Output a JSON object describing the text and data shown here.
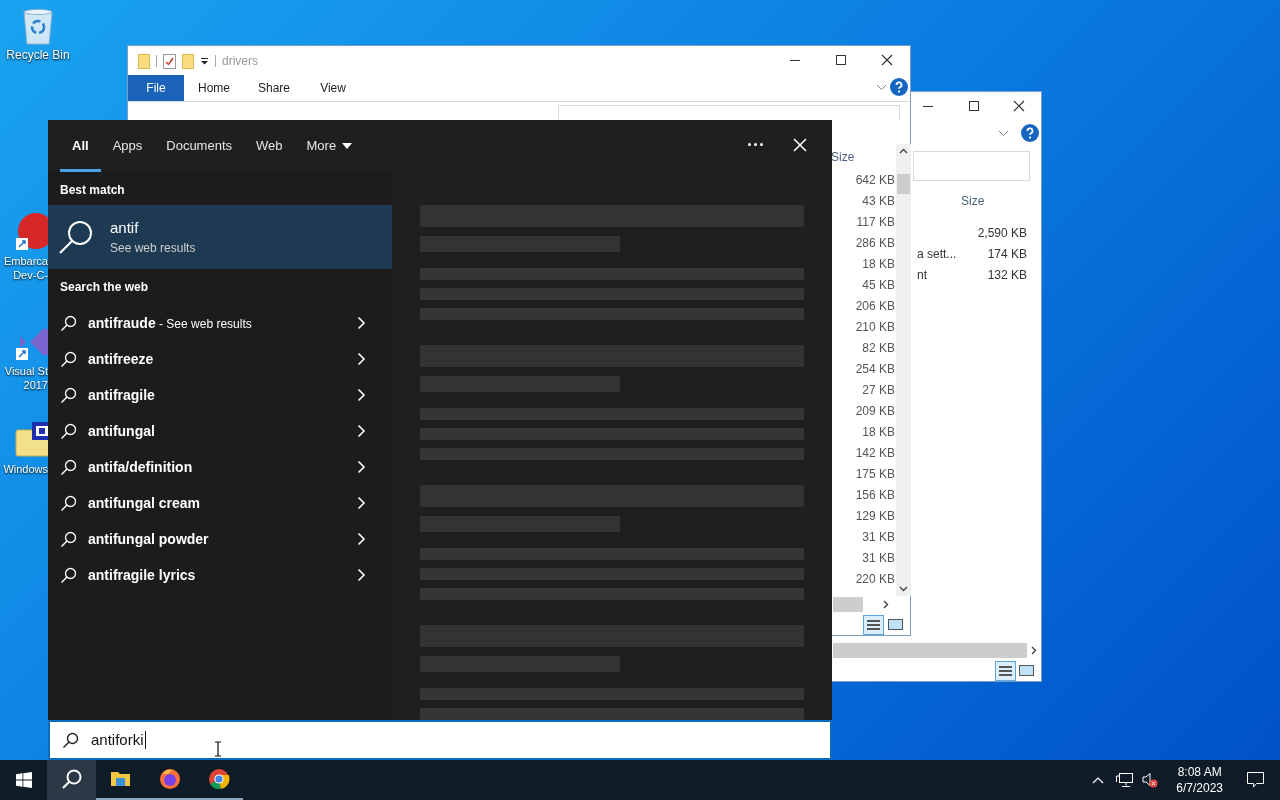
{
  "desktop_icons": [
    {
      "kind": "recycle",
      "lines": [
        "Recycle Bin"
      ]
    },
    {
      "kind": "devcpp",
      "lines": [
        "Embarca",
        "Dev-C-"
      ]
    },
    {
      "kind": "studio",
      "lines": [
        "Visual St",
        "2017"
      ]
    },
    {
      "kind": "setup",
      "lines": [
        "Windows"
      ]
    }
  ],
  "explorer_back": {
    "size_header": "Size",
    "rows": [
      {
        "size": "2,590 KB"
      },
      {
        "name": "a sett...",
        "size": "174 KB"
      },
      {
        "name": "nt",
        "size": "132 KB"
      }
    ]
  },
  "explorer_front": {
    "title": "drivers",
    "ribbon_tabs": [
      {
        "label": "File",
        "selected": true
      },
      {
        "label": "Home",
        "selected": false
      },
      {
        "label": "Share",
        "selected": false
      },
      {
        "label": "View",
        "selected": false
      }
    ],
    "size_header": "Size",
    "sizes": [
      "642 KB",
      "43 KB",
      "117 KB",
      "286 KB",
      "18 KB",
      "45 KB",
      "206 KB",
      "210 KB",
      "82 KB",
      "254 KB",
      "27 KB",
      "209 KB",
      "18 KB",
      "142 KB",
      "175 KB",
      "156 KB",
      "129 KB",
      "31 KB",
      "31 KB",
      "220 KB"
    ]
  },
  "search": {
    "tabs": [
      {
        "label": "All",
        "selected": true
      },
      {
        "label": "Apps",
        "selected": false
      },
      {
        "label": "Documents",
        "selected": false
      },
      {
        "label": "Web",
        "selected": false
      },
      {
        "label": "More",
        "selected": false,
        "kind": "dropdown"
      }
    ],
    "best_match_header": "Best match",
    "best_match": {
      "title": "antif",
      "subtitle": "See web results"
    },
    "web_header": "Search the web",
    "suggestions": [
      {
        "text": "antifraude",
        "suffix": " - See web results"
      },
      {
        "text": "antifreeze"
      },
      {
        "text": "antifragile"
      },
      {
        "text": "antifungal"
      },
      {
        "text": "antifa/definition"
      },
      {
        "text": "antifungal cream"
      },
      {
        "text": "antifungal powder"
      },
      {
        "text": "antifragile lyrics"
      }
    ],
    "query": "antiforki"
  },
  "taskbar": {
    "apps": [
      {
        "kind": "search",
        "active": true
      },
      {
        "kind": "explorer",
        "active": false
      },
      {
        "kind": "firefox",
        "active": false
      },
      {
        "kind": "chrome",
        "active": false
      }
    ],
    "time": "8:08 AM",
    "date": "6/7/2023"
  }
}
